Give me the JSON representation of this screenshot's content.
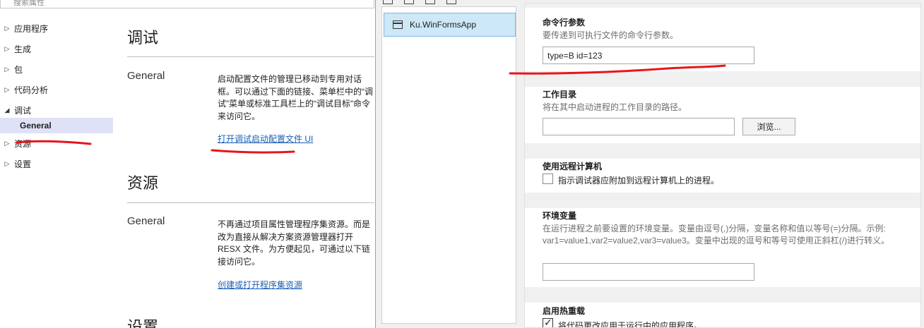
{
  "left": {
    "search_placeholder": "搜索属性",
    "tree": [
      {
        "label": "应用程序",
        "caret": "▷"
      },
      {
        "label": "生成",
        "caret": "▷"
      },
      {
        "label": "包",
        "caret": "▷"
      },
      {
        "label": "代码分析",
        "caret": "▷"
      },
      {
        "label": "调试",
        "caret": "◢"
      },
      {
        "label": "General",
        "caret": ""
      },
      {
        "label": "资源",
        "caret": "▷"
      },
      {
        "label": "设置",
        "caret": "▷"
      }
    ],
    "debug": {
      "title": "调试",
      "sub": "General",
      "desc": "启动配置文件的管理已移动到专用对话框。可以通过下面的链接、菜单栏中的“调试”菜单或标准工具栏上的“调试目标”命令来访问它。",
      "link": "打开调试启动配置文件 UI"
    },
    "resources": {
      "title": "资源",
      "sub": "General",
      "desc": "不再通过项目属性管理程序集资源。而是改为直接从解决方案资源管理器打开 RESX 文件。为方便起见，可通过以下链接访问它。",
      "link": "创建或打开程序集资源"
    },
    "settings_title": "设置"
  },
  "dialog": {
    "profile": "Ku.WinFormsApp",
    "cmd_label": "命令行参数",
    "cmd_desc": "要传递到可执行文件的命令行参数。",
    "cmd_value": "type=B id=123",
    "workdir_label": "工作目录",
    "workdir_desc": "将在其中启动进程的工作目录的路径。",
    "workdir_value": "",
    "browse_label": "浏览...",
    "remote_label": "使用远程计算机",
    "remote_check": "指示调试器应附加到远程计算机上的进程。",
    "env_label": "环境变量",
    "env_desc": "在运行进程之前要设置的环境变量。变量由逗号(,)分隔，变量名称和值以等号(=)分隔。示例: var1=value1,var2=value2,var3=value3。变量中出现的逗号和等号可使用正斜杠(/)进行转义。",
    "env_value": "",
    "hotreload_label": "启用热重载",
    "hotreload_check": "将代码更改应用于运行中的应用程序。"
  },
  "colors": {
    "annotation_red": "#e8151b",
    "link_blue": "#1a5fb4",
    "selected_bg": "#dfe1f6"
  }
}
